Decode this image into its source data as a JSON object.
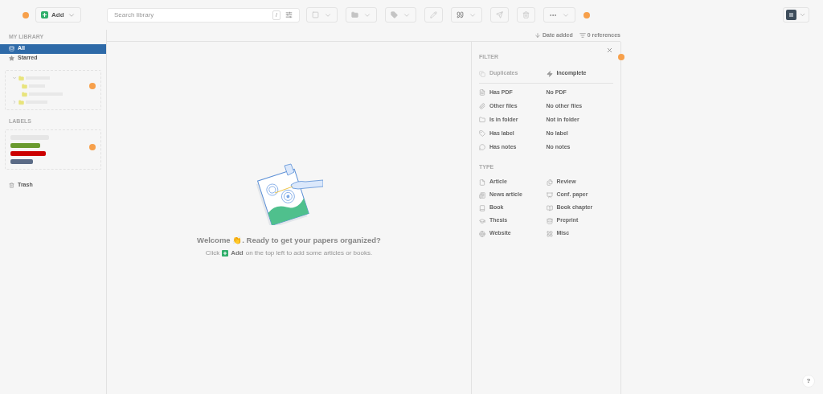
{
  "toolbar": {
    "add_button": {
      "label": "Add"
    },
    "search": {
      "placeholder": "Search library",
      "shortcut": "/"
    }
  },
  "sidebar": {
    "library_title": "MY LIBRARY",
    "items": [
      {
        "label": "All",
        "selected": true
      },
      {
        "label": "Starred",
        "selected": false
      }
    ],
    "labels_title": "LABELS",
    "labels": [
      {
        "color": "#e6e6e6"
      },
      {
        "color": "#6a9a2e"
      },
      {
        "color": "#cc0000"
      },
      {
        "color": "#5b6b86"
      }
    ],
    "trash": "Trash"
  },
  "list_header": {
    "sort": "Date added",
    "count": "0 references"
  },
  "empty_state": {
    "welcome": "Welcome 👏. Ready to get your papers organized?",
    "hint_before": "Click",
    "hint_add": "Add",
    "hint_after": "on the top left to add some articles or books."
  },
  "filter_panel": {
    "title": "FILTER",
    "top": [
      {
        "label": "Duplicates",
        "disabled": true
      },
      {
        "label": "Incomplete",
        "disabled": false
      }
    ],
    "rows": [
      {
        "label": "Has PDF",
        "opposite": "No PDF"
      },
      {
        "label": "Other files",
        "opposite": "No other files"
      },
      {
        "label": "Is in folder",
        "opposite": "Not in folder"
      },
      {
        "label": "Has label",
        "opposite": "No label"
      },
      {
        "label": "Has notes",
        "opposite": "No notes"
      }
    ],
    "type_title": "TYPE",
    "types": [
      {
        "label": "Article"
      },
      {
        "label": "Review"
      },
      {
        "label": "News article"
      },
      {
        "label": "Conf. paper"
      },
      {
        "label": "Book"
      },
      {
        "label": "Book chapter"
      },
      {
        "label": "Thesis"
      },
      {
        "label": "Preprint"
      },
      {
        "label": "Website"
      },
      {
        "label": "Misc"
      }
    ]
  },
  "help": "?"
}
